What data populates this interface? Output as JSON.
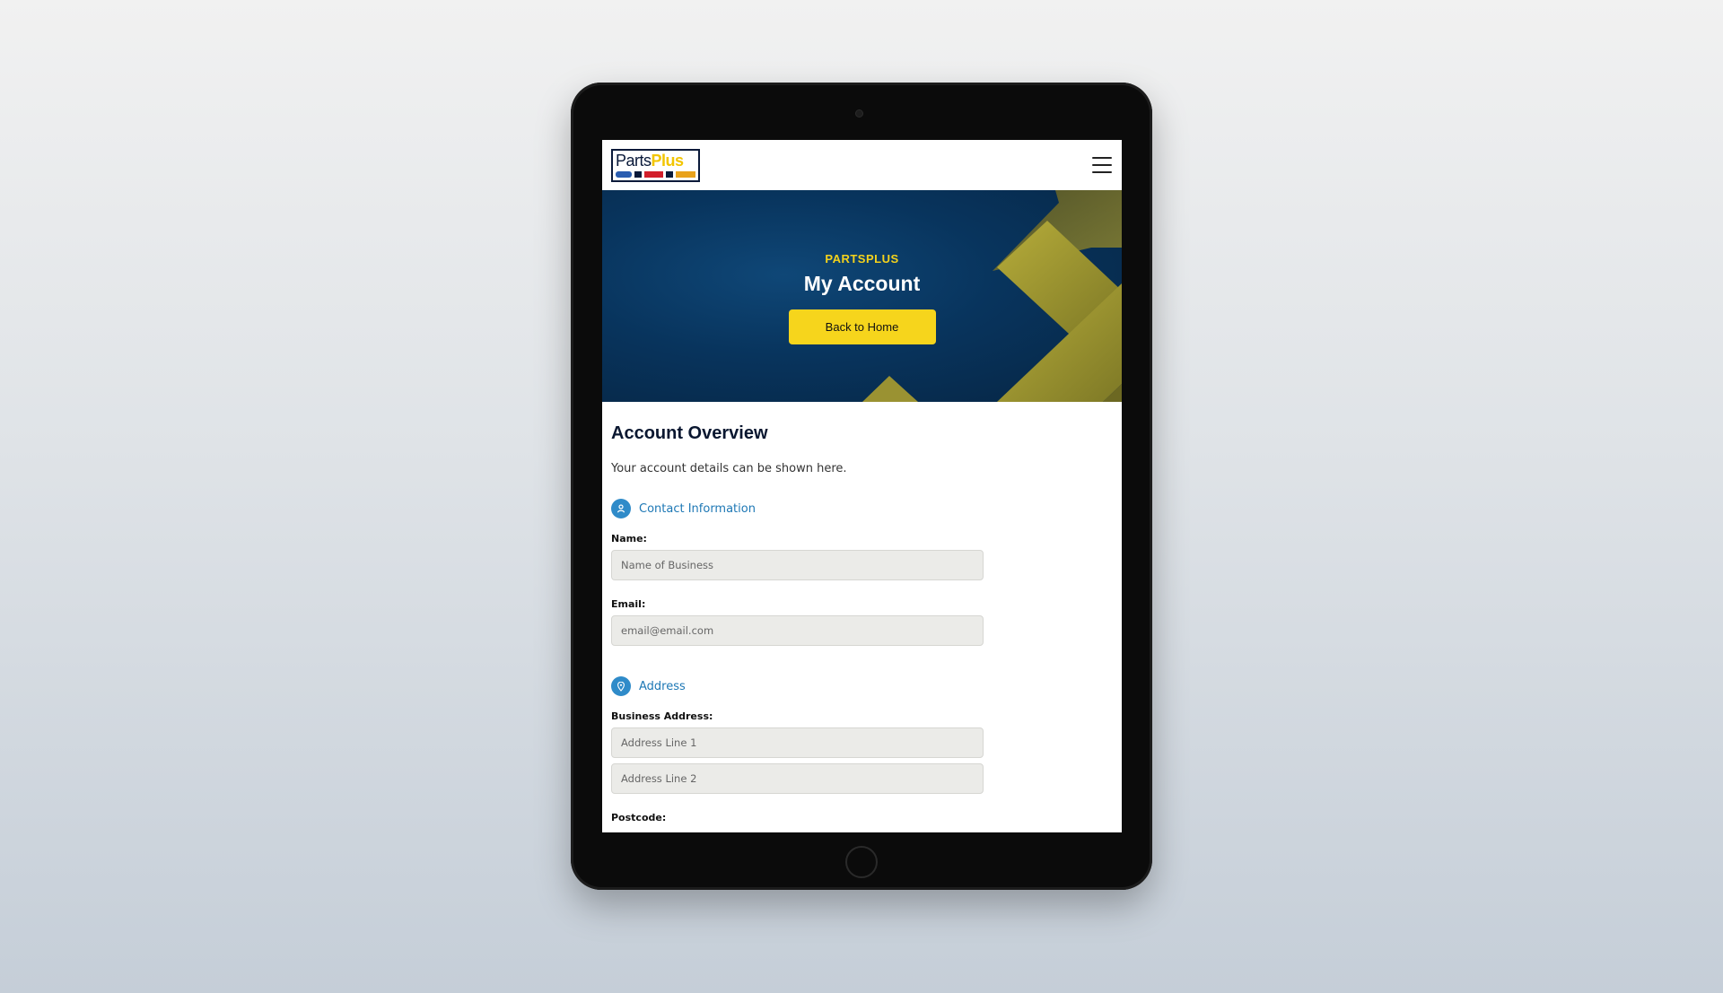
{
  "logo": {
    "text_main": "Parts",
    "text_accent": "Plus",
    "colors": {
      "navy": "#0a1a3a",
      "yellow": "#f2c500",
      "blue": "#2a5db0",
      "red": "#d21f2b"
    }
  },
  "nav": {
    "menu_icon": "hamburger-menu-icon"
  },
  "hero": {
    "eyebrow": "PARTSPLUS",
    "title": "My Account",
    "button_label": "Back to Home",
    "colors": {
      "background": "#08345d",
      "accent": "#f6d51c",
      "shape": "#a39a30"
    }
  },
  "overview": {
    "title": "Account Overview",
    "description": "Your account details can be shown here.",
    "contact": {
      "heading": "Contact Information",
      "icon": "user-icon",
      "name_label": "Name:",
      "name_placeholder": "Name of Business",
      "email_label": "Email:",
      "email_placeholder": "email@email.com"
    },
    "address": {
      "heading": "Address",
      "icon": "location-pin-icon",
      "business_address_label": "Business Address:",
      "line1_placeholder": "Address Line 1",
      "line2_placeholder": "Address Line 2",
      "postcode_label": "Postcode:"
    }
  }
}
